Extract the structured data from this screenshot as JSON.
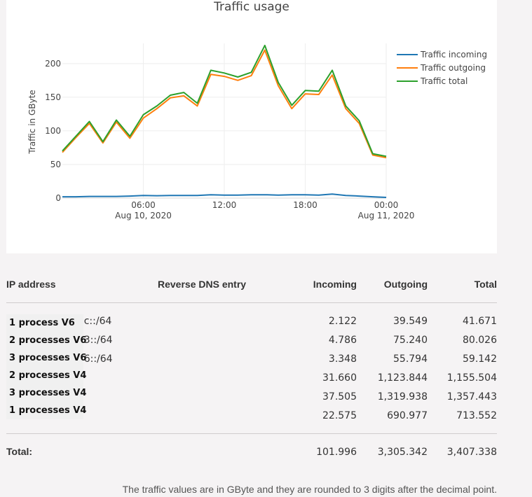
{
  "chart_data": {
    "type": "line",
    "title": "Traffic usage",
    "ylabel": "Traffic in GByte",
    "xlabel": "",
    "ylim": [
      0,
      230
    ],
    "yticks": [
      0,
      50,
      100,
      150,
      200
    ],
    "xticks": [
      {
        "at": 6,
        "label": "06:00",
        "sublabel": "Aug 10, 2020"
      },
      {
        "at": 12,
        "label": "12:00",
        "sublabel": ""
      },
      {
        "at": 18,
        "label": "18:00",
        "sublabel": ""
      },
      {
        "at": 24,
        "label": "00:00",
        "sublabel": "Aug 11, 2020"
      }
    ],
    "x": [
      0,
      1,
      2,
      3,
      4,
      5,
      6,
      7,
      8,
      9,
      10,
      11,
      12,
      13,
      14,
      15,
      16,
      17,
      18,
      19,
      20,
      21,
      22,
      23,
      24
    ],
    "legend_position": "top-right",
    "grid": true,
    "series": [
      {
        "name": "Traffic incoming",
        "color": "#1f77b4",
        "values": [
          2,
          2,
          2.5,
          2.5,
          2.5,
          3,
          4,
          3.5,
          4,
          4,
          4,
          5,
          4.5,
          4.5,
          5,
          5,
          4.5,
          5,
          5,
          4.5,
          6,
          4,
          3,
          2,
          1
        ]
      },
      {
        "name": "Traffic outgoing",
        "color": "#ff7f0e",
        "values": [
          68,
          90,
          111,
          82,
          113,
          89,
          119,
          133,
          149,
          152,
          137,
          184,
          181,
          175,
          182,
          220,
          167,
          133,
          155,
          154,
          183,
          133,
          111,
          64,
          60
        ]
      },
      {
        "name": "Traffic total",
        "color": "#2ca02c",
        "values": [
          70,
          92,
          114,
          84,
          116,
          92,
          124,
          137,
          153,
          157,
          141,
          190,
          186,
          180,
          187,
          227,
          172,
          138,
          160,
          159,
          190,
          137,
          115,
          66,
          62
        ]
      }
    ]
  },
  "table": {
    "headers": {
      "ip": "IP address",
      "rdns": "Reverse DNS entry",
      "incoming": "Incoming",
      "outgoing": "Outgoing",
      "total": "Total"
    },
    "rows": [
      {
        "ip_fragment": "ːc::/64",
        "incoming": "2.122",
        "outgoing": "39.549",
        "total": "41.671"
      },
      {
        "ip_fragment": "ː3::/64",
        "incoming": "4.786",
        "outgoing": "75.240",
        "total": "80.026"
      },
      {
        "ip_fragment": "ː6::/64",
        "incoming": "3.348",
        "outgoing": "55.794",
        "total": "59.142"
      },
      {
        "ip_fragment": "",
        "incoming": "31.660",
        "outgoing": "1,123.844",
        "total": "1,155.504"
      },
      {
        "ip_fragment": "",
        "incoming": "37.505",
        "outgoing": "1,319.938",
        "total": "1,357.443"
      },
      {
        "ip_fragment": "",
        "incoming": "22.575",
        "outgoing": "690.977",
        "total": "713.552"
      }
    ],
    "total_label": "Total:",
    "totals": {
      "incoming": "101.996",
      "outgoing": "3,305.342",
      "total": "3,407.338"
    }
  },
  "overlay_labels": [
    "1 process V6",
    "2 processes V6",
    "3 processes V6",
    "2 processes V4",
    "3 processes V4",
    "1 processes V4"
  ],
  "footnote": "The traffic values are in GByte and they are rounded to 3 digits after the decimal point."
}
